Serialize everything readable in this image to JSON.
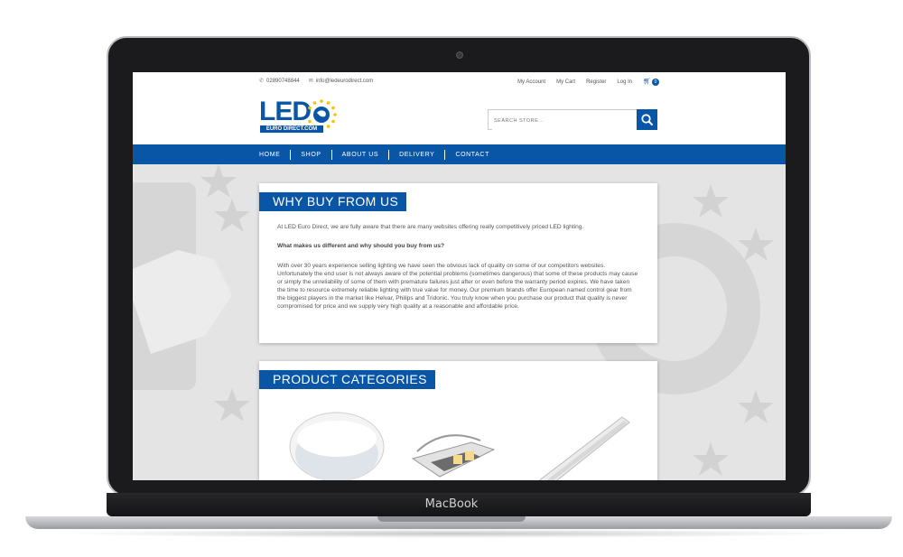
{
  "device": {
    "brand": "MacBook"
  },
  "topbar": {
    "phone": "02890748844",
    "email": "info@ledeurodirect.com",
    "links": [
      "My Account",
      "My Cart",
      "Register",
      "Log In"
    ],
    "cart_count": "0"
  },
  "logo": {
    "main": "LED",
    "sub": "EURO DIRECT.COM"
  },
  "search": {
    "placeholder": "SEARCH STORE..."
  },
  "nav": {
    "items": [
      "HOME",
      "SHOP",
      "ABOUT US",
      "DELIVERY",
      "CONTACT"
    ]
  },
  "why": {
    "title": "WHY BUY FROM US",
    "intro": "At LED Euro Direct, we are fully aware that there are many websites offering really competitively priced LED lighting.",
    "question": "What makes us different and why should you buy from us?",
    "body": "With over 30 years experience selling lighting we have seen the obvious lack of quality on some of our competitors websites. Unfortunately the end user is not always aware of the potential problems (sometimes dangerous) that some of these products may cause or simply the unreliability of some of them with premature failures just after or even before the warranty period expires. We have taken the time to resource extremely reliable lighting with true value for money. Our premium brands offer European named control gear from the biggest players in the market like Helvar, Philips and Tridonic. You truly know when you purchase our product that quality is never compromised for price and we supply very high quality at a reasonable and affordable price."
  },
  "categories": {
    "title": "PRODUCT CATEGORIES"
  },
  "colors": {
    "brand_blue": "#0a56a6",
    "background_gray": "#e4e4e4"
  },
  "icons": [
    "phone-icon",
    "envelope-icon",
    "cart-icon",
    "search-icon",
    "star-icon"
  ]
}
